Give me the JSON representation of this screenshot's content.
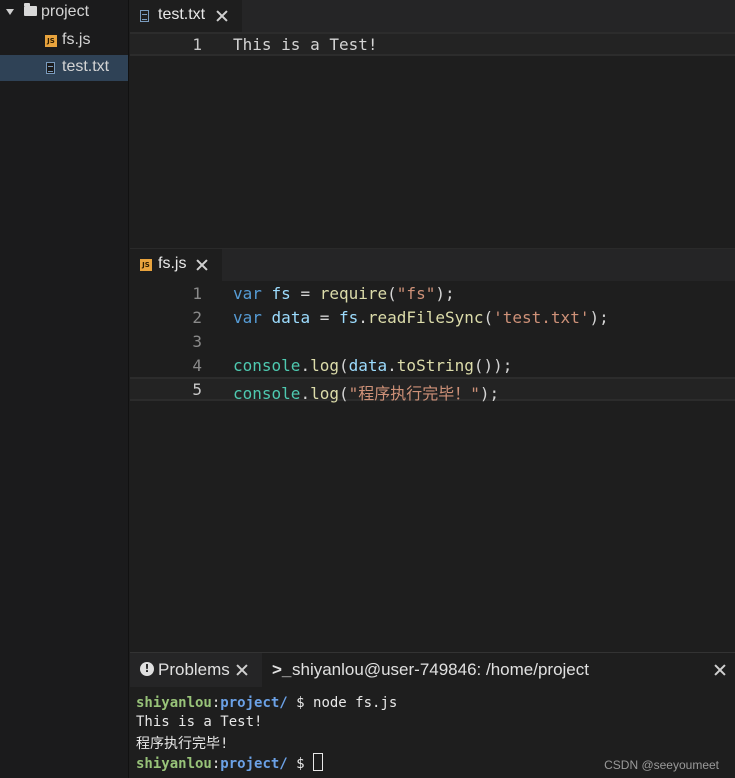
{
  "explorer": {
    "folder": "project",
    "files": [
      {
        "name": "fs.js",
        "icon": "js-file-icon"
      },
      {
        "name": "test.txt",
        "icon": "text-file-icon"
      }
    ]
  },
  "editor_top": {
    "tab_label": "test.txt",
    "lines": [
      {
        "number": "1",
        "text": "This is a Test!"
      }
    ]
  },
  "editor_bottom": {
    "tab_label": "fs.js",
    "js_icon_text": "JS",
    "line_numbers": [
      "1",
      "2",
      "3",
      "4",
      "5"
    ],
    "line1": {
      "kw": "var",
      "name": "fs",
      "op": " = ",
      "call": "require",
      "open": "(",
      "arg": "\"fs\"",
      "close": ");"
    },
    "line2": {
      "kw": "var",
      "name": "data",
      "op": " = ",
      "obj": "fs",
      "dot": ".",
      "call": "readFileSync",
      "open": "(",
      "arg": "'test.txt'",
      "close": ");"
    },
    "line4": {
      "obj": "console",
      "dot": ".",
      "call": "log",
      "open": "(",
      "name": "data",
      "dot2": ".",
      "call2": "toString",
      "close": "());"
    },
    "line5": {
      "obj": "console",
      "dot": ".",
      "call": "log",
      "open": "(",
      "arg": "\"程序执行完毕！\"",
      "close": ");"
    }
  },
  "panel": {
    "problems_tab": "Problems",
    "problems_icon_text": "!",
    "terminal_prompt_icon": ">_",
    "terminal_tab": "shiyanlou@user-749846: /home/project",
    "terminal_lines": [
      {
        "user": "shiyanlou",
        "colon": ":",
        "path": "project/",
        "cmd": " $ node fs.js"
      },
      {
        "output": "This is a Test!"
      },
      {
        "output": "程序执行完毕!"
      },
      {
        "user": "shiyanlou",
        "colon": ":",
        "path": "project/",
        "cmd": " $ "
      }
    ]
  },
  "watermark": "CSDN @seeyoumeet",
  "colors": {
    "keyword": "#569cd6",
    "string": "#ce9178",
    "function": "#dcdcaa",
    "variable": "#9cdcfe",
    "selection": "#2f4256",
    "prompt_user": "#98c379",
    "prompt_path": "#6ba1e6"
  }
}
